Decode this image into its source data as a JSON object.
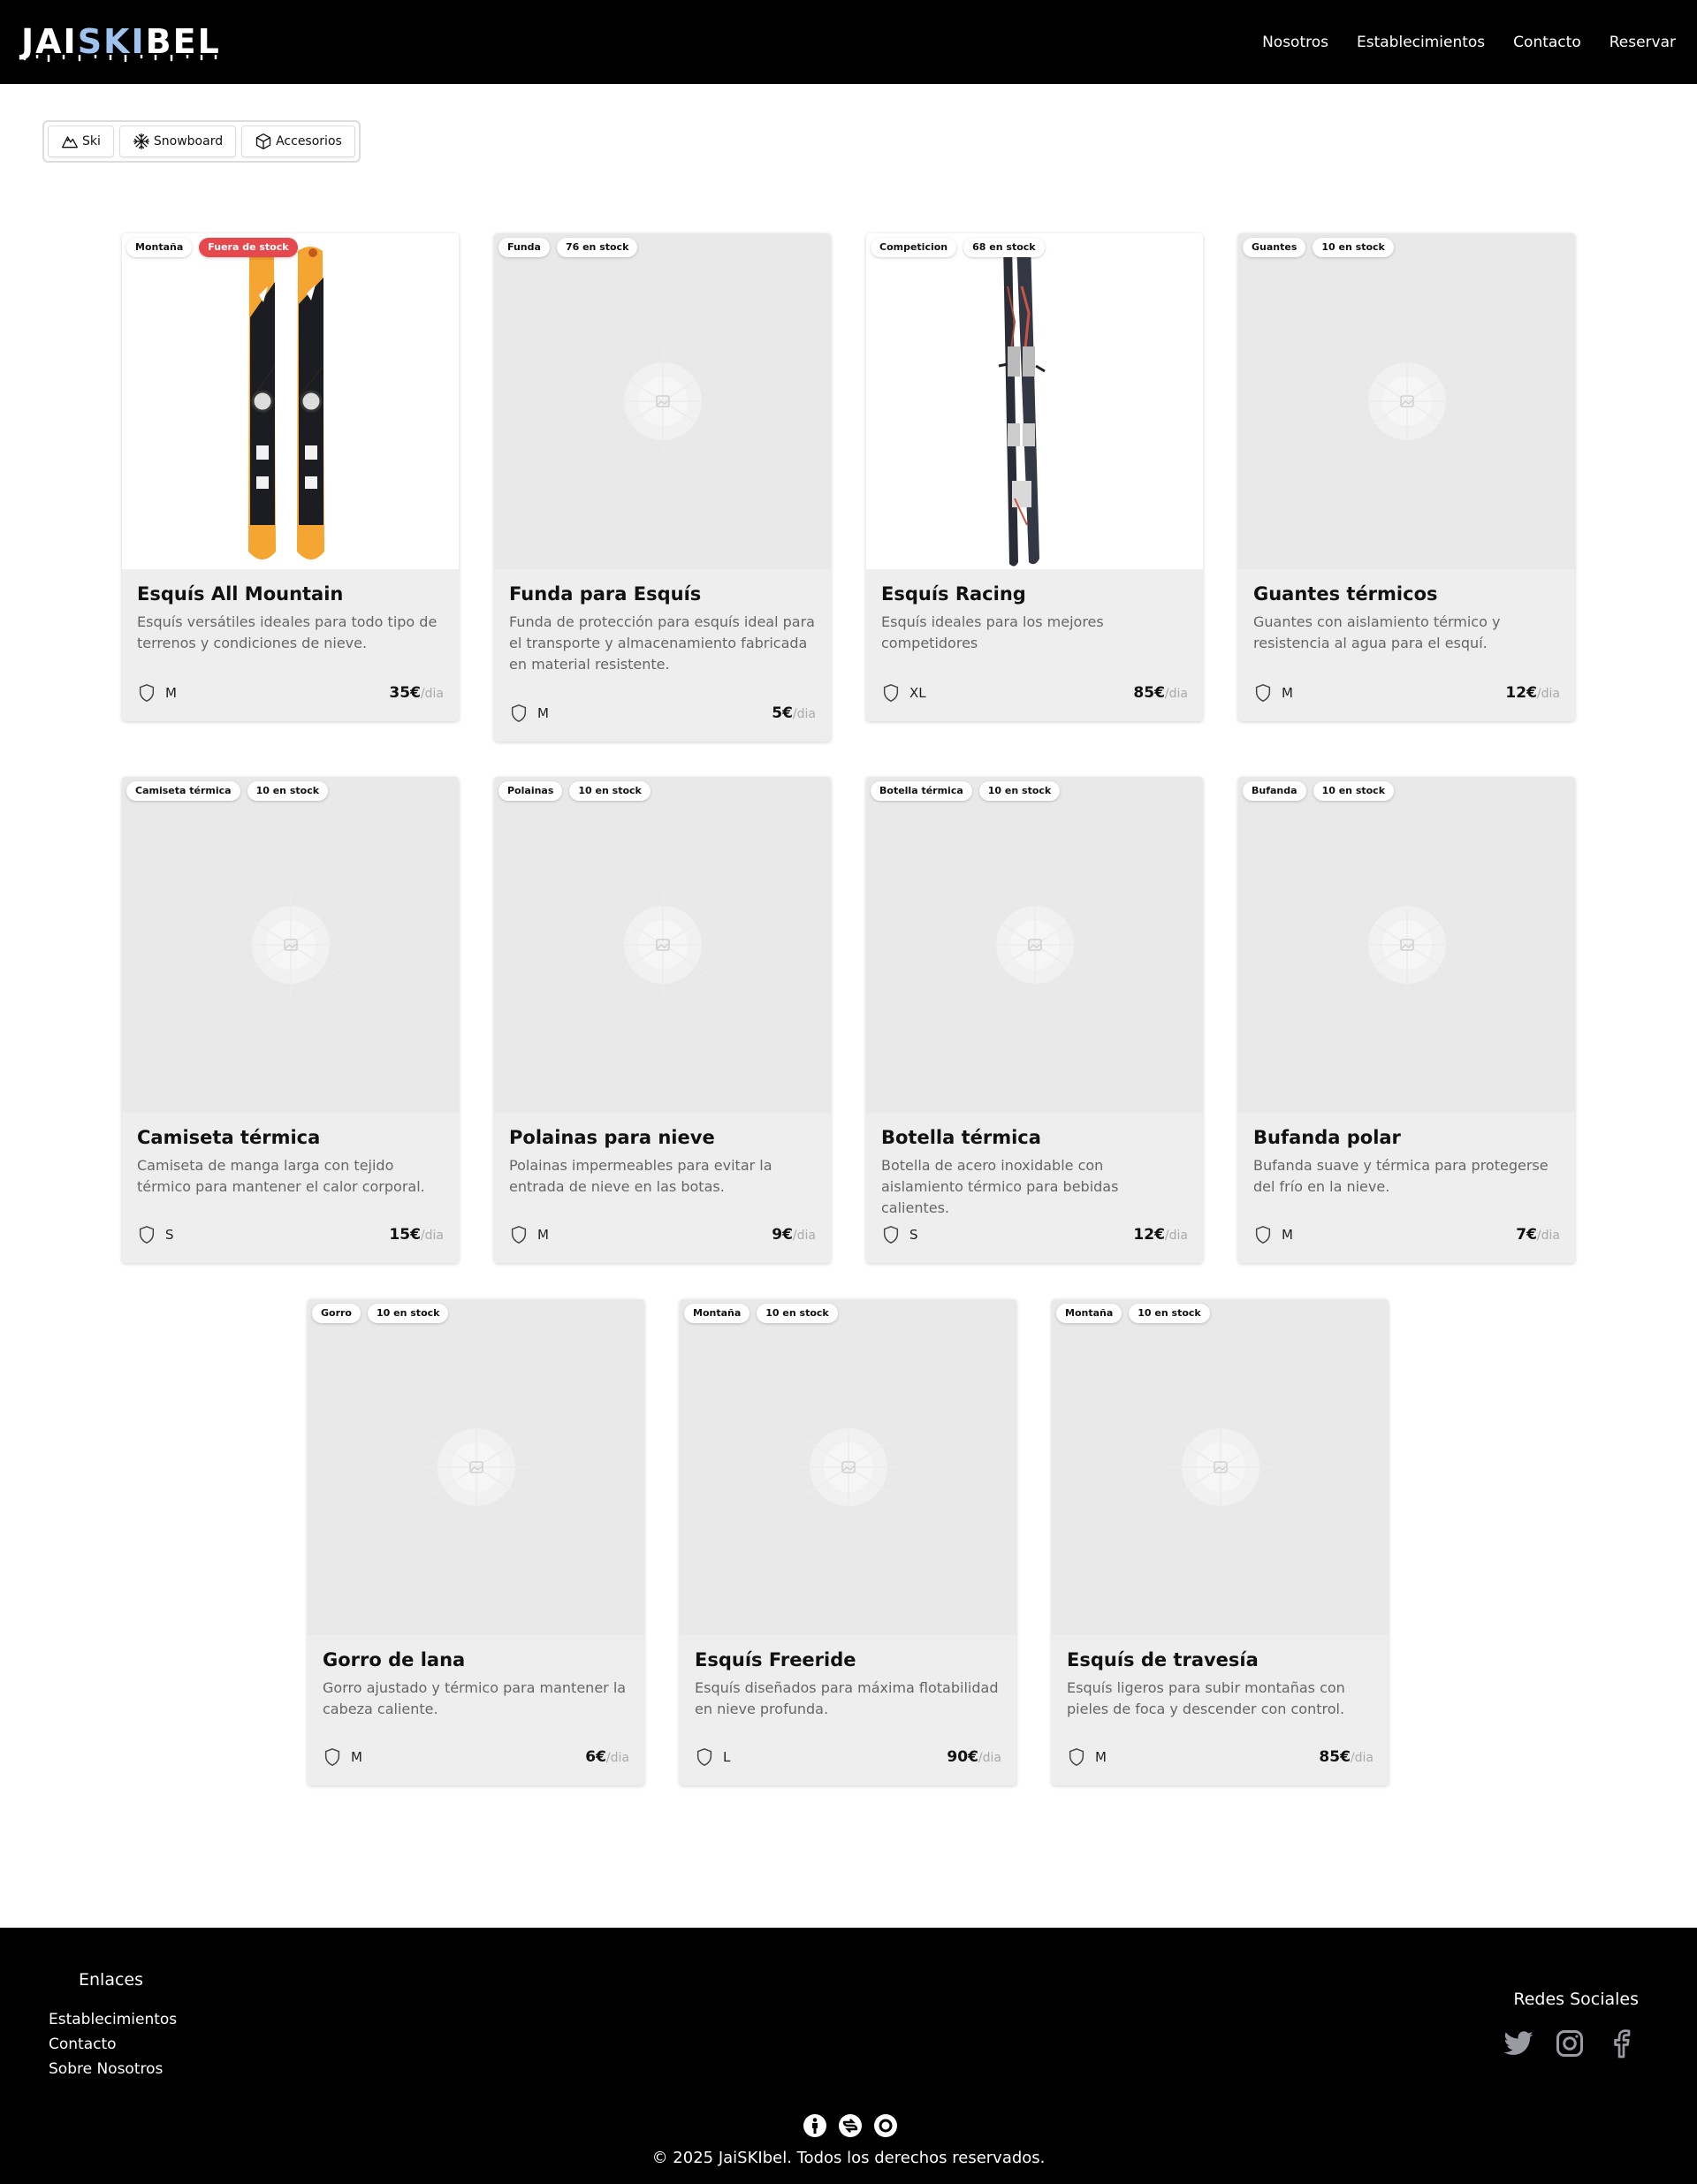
{
  "header": {
    "logo_prefix": "JAI",
    "logo_highlight": "SKI",
    "logo_suffix": "BEL",
    "nav": [
      "Nosotros",
      "Establecimientos",
      "Contacto",
      "Reservar"
    ]
  },
  "filters": [
    {
      "label": "Ski",
      "icon": "mountain-icon"
    },
    {
      "label": "Snowboard",
      "icon": "snowflake-icon"
    },
    {
      "label": "Accesorios",
      "icon": "box-icon"
    }
  ],
  "currency_per": "/dia",
  "products": [
    {
      "category": "Montaña",
      "stock": "Fuera de stock",
      "stock_alert": true,
      "image": "ski-orange",
      "name": "Esquís All Mountain",
      "description": "Esquís versátiles ideales para todo tipo de terrenos y condiciones de nieve.",
      "size": "M",
      "price": "35€"
    },
    {
      "category": "Funda",
      "stock": "76 en stock",
      "stock_alert": false,
      "image": "placeholder",
      "name": "Funda para Esquís",
      "description": "Funda de protección para esquís ideal para el transporte y almacenamiento fabricada en material resistente.",
      "size": "M",
      "price": "5€"
    },
    {
      "category": "Competicion",
      "stock": "68 en stock",
      "stock_alert": false,
      "image": "ski-dark",
      "name": "Esquís Racing",
      "description": "Esquís ideales para los mejores competidores",
      "size": "XL",
      "price": "85€"
    },
    {
      "category": "Guantes",
      "stock": "10 en stock",
      "stock_alert": false,
      "image": "placeholder",
      "name": "Guantes térmicos",
      "description": "Guantes con aislamiento térmico y resistencia al agua para el esquí.",
      "size": "M",
      "price": "12€"
    },
    {
      "category": "Camiseta térmica",
      "stock": "10 en stock",
      "stock_alert": false,
      "image": "placeholder",
      "name": "Camiseta térmica",
      "description": "Camiseta de manga larga con tejido térmico para mantener el calor corporal.",
      "size": "S",
      "price": "15€"
    },
    {
      "category": "Polainas",
      "stock": "10 en stock",
      "stock_alert": false,
      "image": "placeholder",
      "name": "Polainas para nieve",
      "description": "Polainas impermeables para evitar la entrada de nieve en las botas.",
      "size": "M",
      "price": "9€"
    },
    {
      "category": "Botella térmica",
      "stock": "10 en stock",
      "stock_alert": false,
      "image": "placeholder",
      "name": "Botella térmica",
      "description": "Botella de acero inoxidable con aislamiento térmico para bebidas calientes.",
      "size": "S",
      "price": "12€"
    },
    {
      "category": "Bufanda",
      "stock": "10 en stock",
      "stock_alert": false,
      "image": "placeholder",
      "name": "Bufanda polar",
      "description": "Bufanda suave y térmica para protegerse del frío en la nieve.",
      "size": "M",
      "price": "7€"
    },
    {
      "category": "Gorro",
      "stock": "10 en stock",
      "stock_alert": false,
      "image": "placeholder",
      "name": "Gorro de lana",
      "description": "Gorro ajustado y térmico para mantener la cabeza caliente.",
      "size": "M",
      "price": "6€"
    },
    {
      "category": "Montaña",
      "stock": "10 en stock",
      "stock_alert": false,
      "image": "placeholder",
      "name": "Esquís Freeride",
      "description": "Esquís diseñados para máxima flotabilidad en nieve profunda.",
      "size": "L",
      "price": "90€"
    },
    {
      "category": "Montaña",
      "stock": "10 en stock",
      "stock_alert": false,
      "image": "placeholder",
      "name": "Esquís de travesía",
      "description": "Esquís ligeros para subir montañas con pieles de foca y descender con control.",
      "size": "M",
      "price": "85€"
    }
  ],
  "footer": {
    "links_title": "Enlaces",
    "links": [
      "Establecimientos",
      "Contacto",
      "Sobre Nosotros"
    ],
    "social_title": "Redes Sociales",
    "socials": [
      "twitter-icon",
      "instagram-icon",
      "facebook-icon"
    ],
    "license_icons": [
      "cc-by-icon",
      "cc-share-icon",
      "cc-nc-icon"
    ],
    "copyright": "© 2025 JaiSKIbel. Todos los derechos reservados."
  },
  "colors": {
    "header_bg": "#000000",
    "logo_accent": "#9fc3ec",
    "out_of_stock": "#e5484d",
    "card_bg": "#eeeeee",
    "page_bg": "#ffffff"
  }
}
